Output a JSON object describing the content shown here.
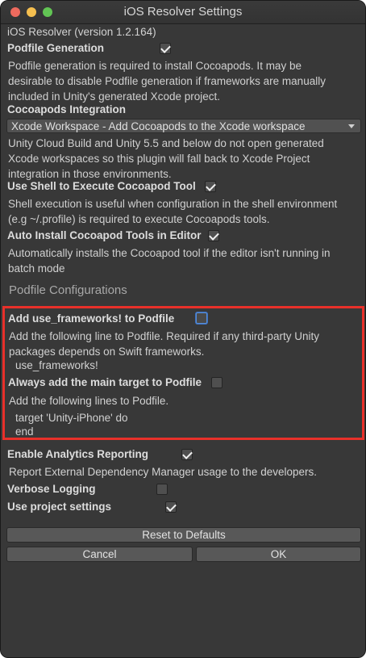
{
  "window": {
    "title": "iOS Resolver Settings"
  },
  "version_label": "iOS Resolver (version 1.2.164)",
  "podfile_generation": {
    "label": "Podfile Generation",
    "checked": true,
    "description": [
      "Podfile generation is required to install Cocoapods.  It may be",
      "desirable to disable Podfile generation if frameworks are manually",
      "included in Unity's generated Xcode project."
    ]
  },
  "cocoapods_integration": {
    "label": "Cocoapods Integration",
    "selected": "Xcode Workspace - Add Cocoapods to the Xcode workspace",
    "description": [
      "Unity Cloud Build and Unity 5.5 and below do not open generated",
      "Xcode workspaces so this plugin will fall back to Xcode Project",
      "integration in those environments."
    ]
  },
  "use_shell": {
    "label": "Use Shell to Execute Cocoapod Tool",
    "checked": true,
    "description": [
      "Shell execution is useful when configuration in the shell environment",
      "(e.g ~/.profile) is required to execute Cocoapods tools."
    ]
  },
  "auto_install": {
    "label": "Auto Install Cocoapod Tools in Editor",
    "checked": true,
    "description": [
      "Automatically installs the Cocoapod tool if the editor isn't running in",
      "batch mode"
    ]
  },
  "podfile_configurations": {
    "header": "Podfile Configurations",
    "use_frameworks": {
      "label": "Add use_frameworks! to Podfile",
      "checked": false,
      "description": [
        "Add the following line to Podfile. Required if any third-party Unity",
        "packages depends on Swift frameworks."
      ],
      "code": "use_frameworks!"
    },
    "main_target": {
      "label": "Always add the main target to Podfile",
      "checked": false,
      "description": "Add the following lines to Podfile.",
      "code": [
        "target 'Unity-iPhone' do",
        "end"
      ]
    }
  },
  "analytics": {
    "label": "Enable Analytics Reporting",
    "checked": true,
    "description": "Report External Dependency Manager usage to the developers."
  },
  "verbose_logging": {
    "label": "Verbose Logging",
    "checked": false
  },
  "project_settings": {
    "label": "Use project settings",
    "checked": true
  },
  "buttons": {
    "reset": "Reset to Defaults",
    "cancel": "Cancel",
    "ok": "OK"
  },
  "colors": {
    "highlight": "#e8302a",
    "focus": "#5a8fd6"
  }
}
